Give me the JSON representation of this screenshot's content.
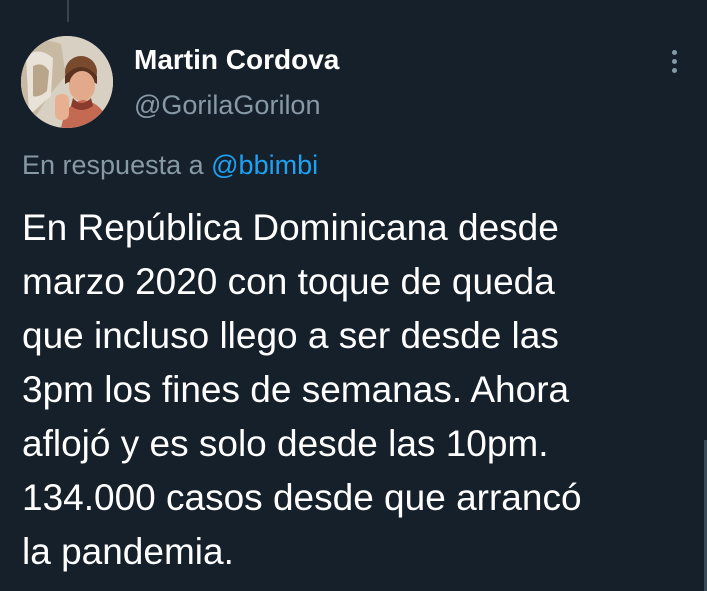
{
  "tweet": {
    "author": {
      "display_name": "Martin Cordova",
      "handle": "@GorilaGorilon"
    },
    "reply_prefix": "En respuesta a",
    "reply_mention": "@bbimbi",
    "text_lines": [
      "En República Dominicana desde",
      "marzo 2020 con toque de queda",
      "que incluso llego a ser desde las",
      "3pm los fines de semanas. Ahora",
      "aflojó y es solo desde las 10pm.",
      "134.000 casos desde que arrancó",
      "la pandemia."
    ]
  },
  "icons": {
    "more": "more-vertical-icon"
  },
  "colors": {
    "background": "#15202b",
    "primary_text": "#ffffff",
    "secondary_text": "#8899a6",
    "accent": "#1da1f2"
  }
}
